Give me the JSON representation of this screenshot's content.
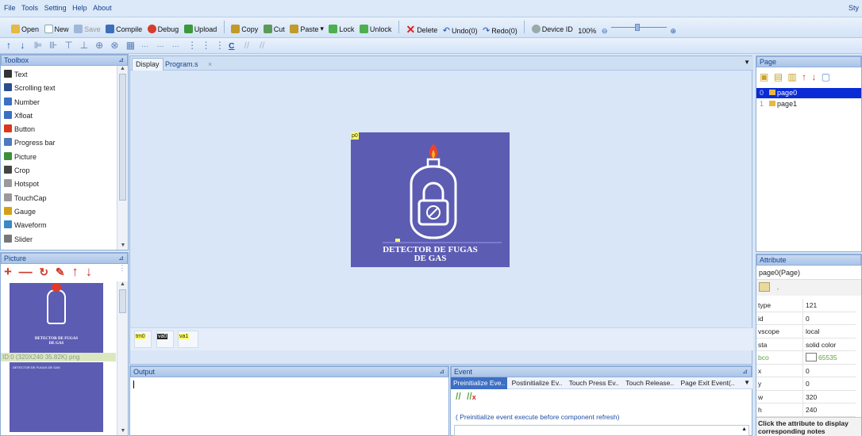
{
  "menu": [
    "File",
    "Tools",
    "Setting",
    "Help",
    "About"
  ],
  "menu_right": "Sty",
  "toolbar": {
    "open": "Open",
    "new": "New",
    "save": "Save",
    "compile": "Compile",
    "debug": "Debug",
    "upload": "Upload",
    "copy": "Copy",
    "cut": "Cut",
    "paste": "Paste",
    "lock": "Lock",
    "unlock": "Unlock",
    "delete": "Delete",
    "undo": "Undo(0)",
    "redo": "Redo(0)",
    "device_id": "Device ID",
    "zoom": "100%",
    "zoom_minus": "⊖",
    "zoom_plus": "⊕",
    "align_c": "C"
  },
  "toolbox": {
    "title": "Toolbox",
    "items": [
      {
        "label": "Text",
        "color": "#333333"
      },
      {
        "label": "Scrolling text",
        "color": "#2b4d8c"
      },
      {
        "label": "Number",
        "color": "#3a6fc2"
      },
      {
        "label": "Xfloat",
        "color": "#3a6fc2"
      },
      {
        "label": "Button",
        "color": "#d9381e"
      },
      {
        "label": "Progress bar",
        "color": "#4d79c0"
      },
      {
        "label": "Picture",
        "color": "#3b8f3b"
      },
      {
        "label": "Crop",
        "color": "#444444"
      },
      {
        "label": "Hotspot",
        "color": "#9a9a9a"
      },
      {
        "label": "TouchCap",
        "color": "#9a9a9a"
      },
      {
        "label": "Gauge",
        "color": "#d4a017"
      },
      {
        "label": "Waveform",
        "color": "#3a88c8"
      },
      {
        "label": "Slider",
        "color": "#777777"
      }
    ]
  },
  "picture_panel": {
    "title": "Picture",
    "icons": [
      "+",
      "—",
      "↻",
      "✎",
      "↑",
      "↓"
    ],
    "thumb_line1": "DETECTOR DE FUGAS",
    "thumb_line2": "DE GAS",
    "caption": "ID:0  (320X240 35.82K) png",
    "thumb2_text": "DETECTOR DE FUGAS DE GAS"
  },
  "display": {
    "tabs": [
      {
        "label": "Display"
      },
      {
        "label": "Program.s"
      }
    ],
    "tab_close": "×",
    "canvas_badge": "p0",
    "title_line1": "DETECTOR DE FUGAS",
    "title_line2": "DE GAS",
    "components": [
      "tm0",
      "va0",
      "va1"
    ]
  },
  "page_panel": {
    "title": "Page",
    "pages": [
      {
        "index": "0",
        "name": "page0"
      },
      {
        "index": "1",
        "name": "page1"
      }
    ]
  },
  "attribute": {
    "title": "Attribute",
    "selected": "page0(Page)",
    "rows": [
      {
        "k": "type",
        "v": "121"
      },
      {
        "k": "id",
        "v": "0"
      },
      {
        "k": "vscope",
        "v": "local"
      },
      {
        "k": "sta",
        "v": "solid color"
      },
      {
        "k": "bco",
        "v": "65535"
      },
      {
        "k": "x",
        "v": "0"
      },
      {
        "k": "y",
        "v": "0"
      },
      {
        "k": "w",
        "v": "320"
      },
      {
        "k": "h",
        "v": "240"
      }
    ],
    "note": "Click the attribute to display corresponding notes"
  },
  "output": {
    "title": "Output"
  },
  "event": {
    "title": "Event",
    "tabs": [
      "Preinitialize Eve..",
      "Postinitialize Ev..",
      "Touch Press Ev..",
      "Touch Release..",
      "Page Exit Event(.."
    ],
    "desc": "( Preinitialize event execute before component refresh)"
  },
  "colors": {
    "canvas_bg": "#5c5cb3",
    "accent": "#15428b",
    "selected_row": "#0a2cd6",
    "highlight": "#ffff66"
  }
}
